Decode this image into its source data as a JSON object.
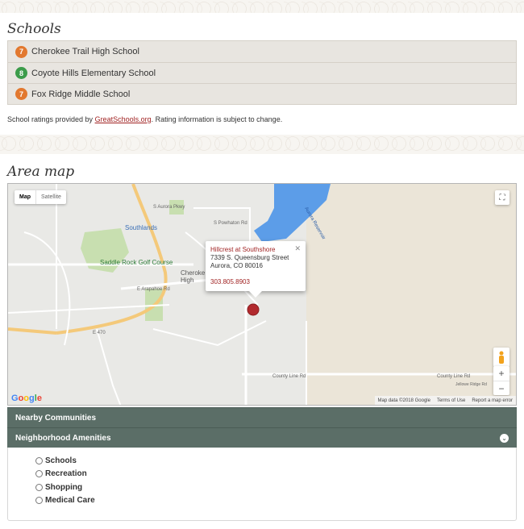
{
  "schools": {
    "title": "Schools",
    "items": [
      {
        "rating": "7",
        "name": "Cherokee Trail High School",
        "color": "#e2782f"
      },
      {
        "rating": "8",
        "name": "Coyote Hills Elementary School",
        "color": "#3c9c4a"
      },
      {
        "rating": "7",
        "name": "Fox Ridge Middle School",
        "color": "#e2782f"
      }
    ],
    "note_prefix": "School ratings provided by ",
    "note_link": "GreatSchools.org",
    "note_suffix": ". Rating information is subject to change."
  },
  "area_map": {
    "title": "Area map",
    "map_type": {
      "map": "Map",
      "satellite": "Satellite"
    },
    "info_window": {
      "name": "Hillcrest at Southshore",
      "street": "7339 S. Queensburg Street",
      "city": "Aurora, CO 80016",
      "phone": "303.805.8903",
      "close": "✕"
    },
    "labels": {
      "southlands": "Southlands",
      "golf": "Saddle Rock Golf Course",
      "cherokee": "Cheroke",
      "high": "High",
      "arapahoe": "E Arapahoe Rd",
      "e470": "E 470",
      "county_line": "County Line Rd",
      "county_line_2": "County Line Rd",
      "aurora_pkwy": "S Aurora Pkwy",
      "powhaton": "S Powhaton Rd",
      "jelloise": "Jellowe Ridge Rd",
      "reservoir": "Aurora Reservoir"
    },
    "google": "Google",
    "footer": {
      "data": "Map data ©2018 Google",
      "terms": "Terms of Use",
      "report": "Report a map error"
    },
    "zoom_in": "+",
    "zoom_out": "−"
  },
  "panels": {
    "nearby": "Nearby Communities",
    "amenities": "Neighborhood Amenities",
    "amenities_chevron": "⌄"
  },
  "amenities": [
    "Schools",
    "Recreation",
    "Shopping",
    "Medical Care"
  ]
}
